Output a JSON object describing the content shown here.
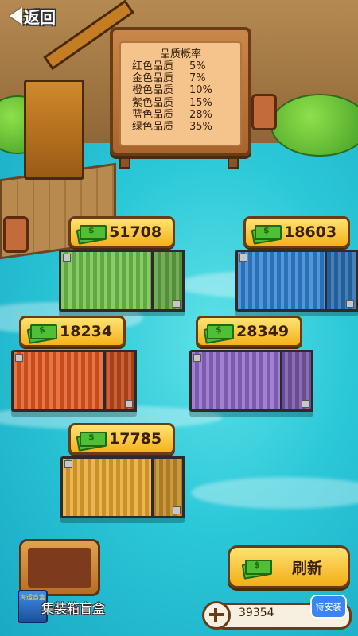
{
  "nav": {
    "back_label": "返回"
  },
  "board": {
    "title": "品质概率",
    "rates": [
      {
        "label": "红色品质",
        "value": "5%"
      },
      {
        "label": "金色品质",
        "value": "7%"
      },
      {
        "label": "橙色品质",
        "value": "10%"
      },
      {
        "label": "紫色品质",
        "value": "15%"
      },
      {
        "label": "蓝色品质",
        "value": "28%"
      },
      {
        "label": "绿色品质",
        "value": "35%"
      }
    ]
  },
  "containers": [
    {
      "color_name": "green",
      "color": "#6fbf4a",
      "price": "51708"
    },
    {
      "color_name": "blue",
      "color": "#2f7fd0",
      "price": "18603"
    },
    {
      "color_name": "orange",
      "color": "#e2571f",
      "price": "18234"
    },
    {
      "color_name": "purple",
      "color": "#8d66c6",
      "price": "28349"
    },
    {
      "color_name": "gold",
      "color": "#e6a52c",
      "price": "17785"
    }
  ],
  "bottom": {
    "blindbox_label": "集装箱盲盒",
    "thumb_label": "海运盲盒",
    "refresh_label": "刷新",
    "balance": "39354",
    "install_label": "待安装"
  }
}
